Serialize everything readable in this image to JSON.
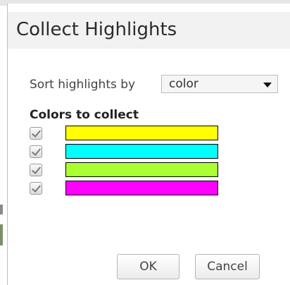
{
  "dialog": {
    "title": "Collect Highlights"
  },
  "sort": {
    "label": "Sort highlights by",
    "selected": "color"
  },
  "colors": {
    "heading": "Colors to collect",
    "items": [
      {
        "name": "yellow",
        "color": "#ffff00",
        "checked": true
      },
      {
        "name": "cyan",
        "color": "#00ffff",
        "checked": true
      },
      {
        "name": "green",
        "color": "#aaff33",
        "checked": true
      },
      {
        "name": "magenta",
        "color": "#ff00ff",
        "checked": true
      }
    ]
  },
  "buttons": {
    "ok": "OK",
    "cancel": "Cancel"
  }
}
